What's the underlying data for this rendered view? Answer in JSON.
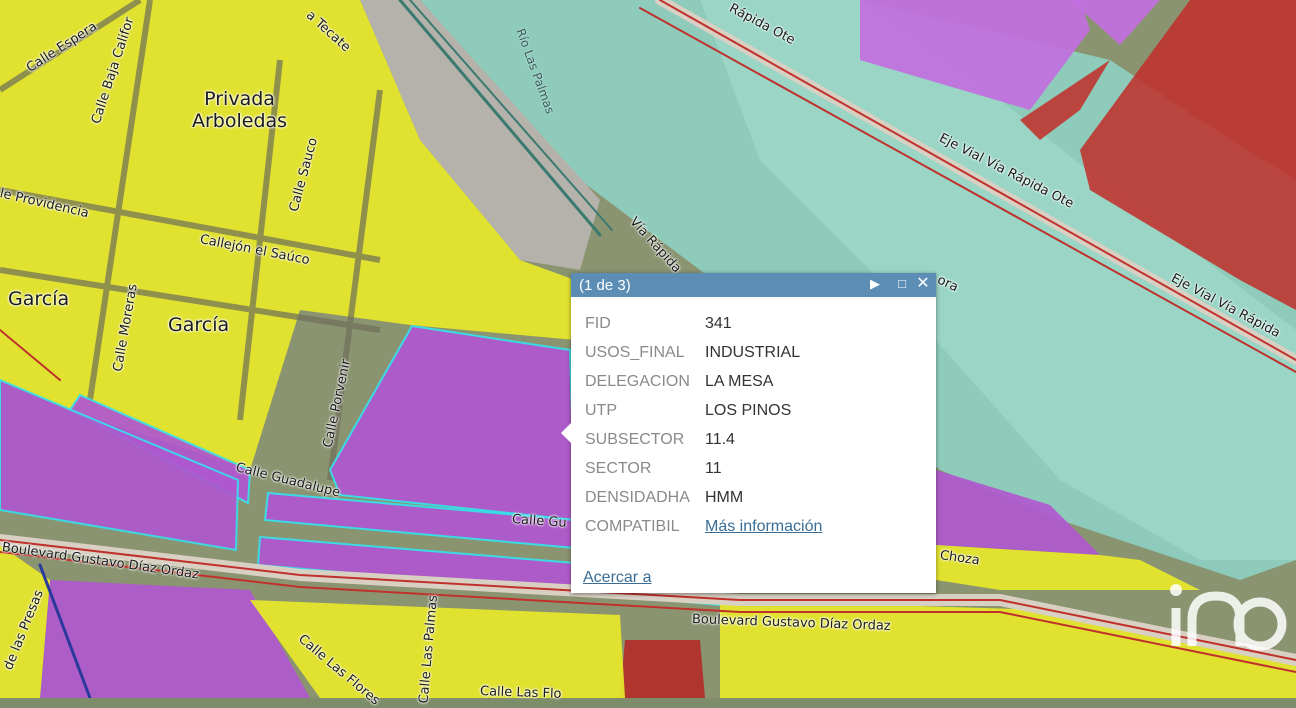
{
  "map": {
    "labels": {
      "privada_arboledas": "Privada\nArboledas",
      "garcia_1": "García",
      "garcia_2": "García",
      "calle_esperanza": "Calle Espera",
      "calle_baja_california": "Calle Baja Califor",
      "calle_tecate": "a Tecate",
      "calle_sauco": "Calle Sauco",
      "providencia": "le Providencia",
      "callejon_el_sauco": "Callejón el Saúco",
      "calle_moreras": "Calle Moreras",
      "calle_porvenir": "Calle Porvenir",
      "calle_guadalupe": "Calle Guadalupe",
      "calle_gu": "Calle Gu",
      "blvd_gdo_1": "Boulevard Gustavo Díaz Ordaz",
      "blvd_gdo_2": "Boulevard Gustavo Díaz Ordaz",
      "calle_presas": "de las Presas",
      "calle_las_flores": "Calle Las Flores",
      "calle_las_palmas": "Calle Las Palmas",
      "calle_las_flores_2": "Calle Las Flo",
      "rio_las_palmas": "Río Las Palmas",
      "via_rapida": "Vía Rápida",
      "via_rapida_ote_top": "Rápida Ote",
      "eje_vial_1": "Eje Vial Vía Rápida Ote",
      "eje_vial_2": "Eje Vial Vía Rápida",
      "ora": "ora",
      "choza": "Choza"
    },
    "colors": {
      "residential": "#e8e82a",
      "industrial": "#b25dd6",
      "commercial": "#c0302c",
      "water": "#8fd6c8",
      "outline_selected": "#36e0ee"
    }
  },
  "popup": {
    "title": "(1 de 3)",
    "rows": [
      {
        "key": "FID",
        "value": "341"
      },
      {
        "key": "USOS_FINAL",
        "value": "INDUSTRIAL"
      },
      {
        "key": "DELEGACION",
        "value": "LA MESA"
      },
      {
        "key": "UTP",
        "value": "LOS PINOS"
      },
      {
        "key": "SUBSECTOR",
        "value": "11.4"
      },
      {
        "key": "SECTOR",
        "value": "11"
      },
      {
        "key": "DENSIDADHA",
        "value": "HMM"
      }
    ],
    "compat_key": "COMPATIBIL",
    "compat_link": "Más información",
    "zoom_link": "Acercar a",
    "icons": [
      "next-icon",
      "maximize-icon",
      "close-icon"
    ]
  },
  "watermark": {
    "text": "iad"
  }
}
